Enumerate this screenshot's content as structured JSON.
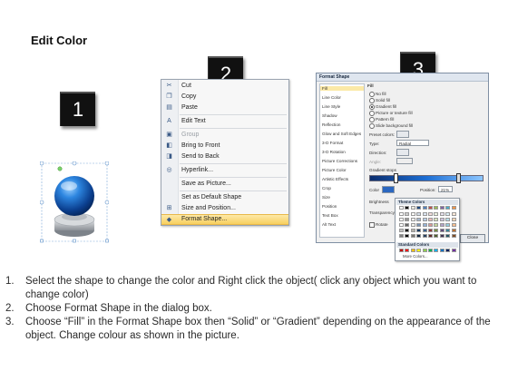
{
  "page": {
    "title": "Edit Color"
  },
  "badges": [
    "1",
    "2",
    "3"
  ],
  "context_menu": {
    "items": [
      {
        "label": "Cut",
        "icon": "scissors-icon",
        "glyph": "✂",
        "disabled": false
      },
      {
        "label": "Copy",
        "icon": "copy-icon",
        "glyph": "❐",
        "disabled": false
      },
      {
        "label": "Paste",
        "icon": "paste-icon",
        "glyph": "📋",
        "disabled": false
      },
      {
        "label": "Edit Text",
        "icon": "edit-text-icon",
        "glyph": "A",
        "disabled": false
      },
      {
        "label": "Group",
        "icon": "group-icon",
        "glyph": "▣",
        "disabled": true
      },
      {
        "label": "Bring to Front",
        "icon": "bring-to-front-icon",
        "glyph": "◧",
        "disabled": false
      },
      {
        "label": "Send to Back",
        "icon": "send-to-back-icon",
        "glyph": "◨",
        "disabled": false
      },
      {
        "label": "Hyperlink...",
        "icon": "hyperlink-icon",
        "glyph": "⚭",
        "disabled": false
      },
      {
        "label": "Save as Picture...",
        "icon": "",
        "glyph": "",
        "disabled": false
      },
      {
        "label": "Set as Default Shape",
        "icon": "",
        "glyph": "",
        "disabled": false
      },
      {
        "label": "Size and Position...",
        "icon": "size-position-icon",
        "glyph": "⊞",
        "disabled": false
      },
      {
        "label": "Format Shape...",
        "icon": "format-shape-icon",
        "glyph": "◆",
        "disabled": false,
        "highlighted": true
      }
    ]
  },
  "format_dialog": {
    "title": "Format Shape",
    "nav": [
      "Fill",
      "Line Color",
      "Line Style",
      "Shadow",
      "Reflection",
      "Glow and Soft Edges",
      "3-D Format",
      "3-D Rotation",
      "Picture Corrections",
      "Picture Color",
      "Artistic Effects",
      "Crop",
      "Size",
      "Position",
      "Text Box",
      "Alt Text"
    ],
    "section": "Fill",
    "fill_options": [
      "No fill",
      "Solid fill",
      "Gradient fill",
      "Picture or texture fill",
      "Pattern fill",
      "Slide background fill"
    ],
    "preset_colors_label": "Preset colors:",
    "type_label": "Type:",
    "type_value": "Radial",
    "direction_label": "Direction:",
    "angle_label": "Angle:",
    "gradient_stops_label": "Gradient stops",
    "color_label": "Color",
    "position_label": "Position:",
    "position_value": "21%",
    "brightness_label": "Brightness",
    "transparency_label": "Transparency",
    "rotate_label": "Rotate",
    "close_label": "Close"
  },
  "color_popup": {
    "theme_label": "Theme Colors",
    "standard_label": "Standard Colors",
    "more_label": "More Colors...",
    "theme_colors": [
      "#ffffff",
      "#000000",
      "#eeece1",
      "#1f497d",
      "#4f81bd",
      "#c0504d",
      "#9bbb59",
      "#8064a2",
      "#4bacc6",
      "#f79646"
    ],
    "standard_colors": [
      "#c00000",
      "#ff0000",
      "#ffc000",
      "#ffff00",
      "#92d050",
      "#00b050",
      "#00b0f0",
      "#0070c0",
      "#002060",
      "#7030a0"
    ]
  },
  "instructions": [
    {
      "num": "1.",
      "text": "Select the shape to change the color and Right click the object( click any object which you want to change color)"
    },
    {
      "num": "2.",
      "text": "Choose Format Shape in the dialog box."
    },
    {
      "num": "3.",
      "text": "Choose “Fill” in the Format Shape box then “Solid” or “Gradient” depending on the appearance of the object. Change colour as shown in the picture."
    }
  ]
}
